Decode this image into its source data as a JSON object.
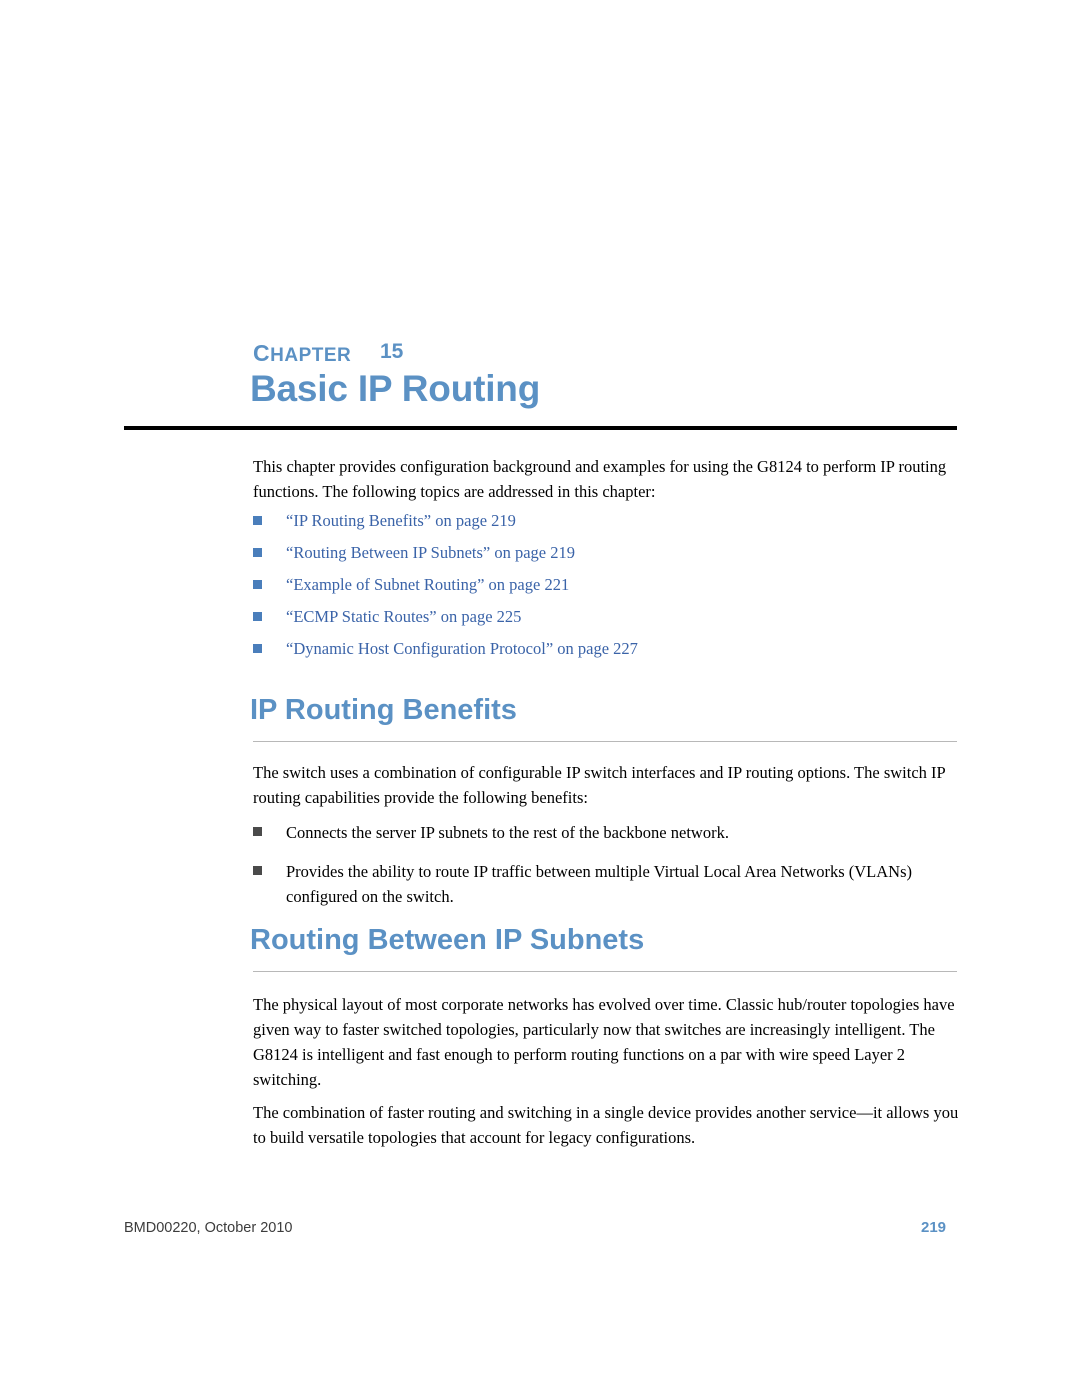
{
  "chapter": {
    "label_first": "C",
    "label_rest": "HAPTER",
    "number": "15",
    "title": "Basic IP Routing"
  },
  "intro": {
    "paragraph": "This chapter provides configuration background and examples for using the G8124 to perform IP routing functions. The following topics are addressed in this chapter:"
  },
  "toc_links": [
    {
      "text": "“IP Routing Benefits” on page 219"
    },
    {
      "text": "“Routing Between IP Subnets” on page 219"
    },
    {
      "text": "“Example of Subnet Routing” on page 221"
    },
    {
      "text": "“ECMP Static Routes” on page 225"
    },
    {
      "text": "“Dynamic Host Configuration Protocol” on page 227"
    }
  ],
  "sections": {
    "benefits": {
      "heading": "IP Routing Benefits",
      "paragraph": "The switch uses a combination of configurable IP switch interfaces and IP routing options. The switch IP routing capabilities provide the following benefits:",
      "bullets": [
        {
          "text": "Connects the server IP subnets to the rest of the backbone network."
        },
        {
          "text": "Provides the ability to route IP traffic between multiple Virtual Local Area Networks (VLANs) configured on the switch."
        }
      ]
    },
    "routing": {
      "heading": "Routing Between IP Subnets",
      "paragraph1": "The physical layout of most corporate networks has evolved over time. Classic hub/router topologies have given way to faster switched topologies, particularly now that switches are increasingly intelligent. The G8124 is intelligent and fast enough to perform routing functions on a par with wire speed Layer 2 switching.",
      "paragraph2": "The combination of faster routing and switching in a single device provides another service—it allows you to build versatile topologies that account for legacy configurations."
    }
  },
  "footer": {
    "left": "BMD00220, October 2010",
    "page_number": "219"
  },
  "colors": {
    "accent": "#5b91c4",
    "link": "#3a63a8",
    "rule": "#000000"
  }
}
